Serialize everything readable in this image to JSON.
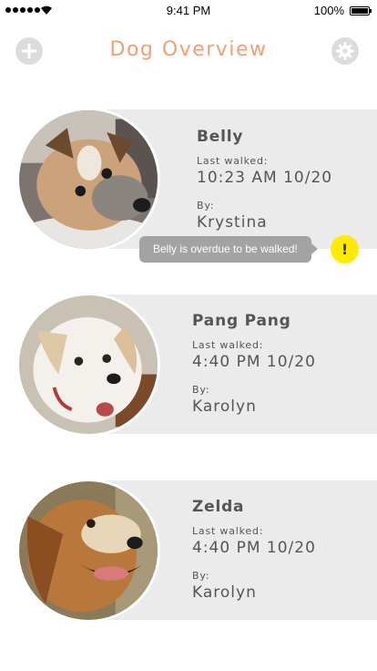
{
  "status_bar": {
    "time": "9:41 PM",
    "battery": "100%"
  },
  "header": {
    "title": "Dog Overview",
    "add_icon": "plus-icon",
    "settings_icon": "gear-icon"
  },
  "dogs": [
    {
      "name": "Belly",
      "last_walked_label": "Last walked:",
      "last_walked": "10:23 AM 10/20",
      "by_label": "By:",
      "by": "Krystina"
    },
    {
      "name": "Pang Pang",
      "last_walked_label": "Last walked:",
      "last_walked": "4:40 PM 10/20",
      "by_label": "By:",
      "by": "Karolyn"
    },
    {
      "name": "Zelda",
      "last_walked_label": "Last walked:",
      "last_walked": "4:40 PM 10/20",
      "by_label": "By:",
      "by": "Karolyn"
    }
  ],
  "alert": {
    "message": "Belly is overdue to be walked!",
    "icon": "!",
    "color": "#ffeb00"
  },
  "colors": {
    "title": "#f1a073",
    "card_background": "#ebebeb",
    "alert_bubble": "#a3a3a3"
  }
}
